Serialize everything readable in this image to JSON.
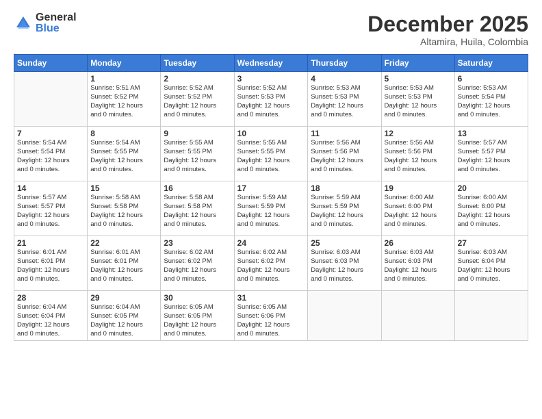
{
  "logo": {
    "general": "General",
    "blue": "Blue"
  },
  "title": {
    "month": "December 2025",
    "location": "Altamira, Huila, Colombia"
  },
  "days_header": [
    "Sunday",
    "Monday",
    "Tuesday",
    "Wednesday",
    "Thursday",
    "Friday",
    "Saturday"
  ],
  "weeks": [
    [
      {
        "day": "",
        "info": ""
      },
      {
        "day": "1",
        "info": "Sunrise: 5:51 AM\nSunset: 5:52 PM\nDaylight: 12 hours\nand 0 minutes."
      },
      {
        "day": "2",
        "info": "Sunrise: 5:52 AM\nSunset: 5:52 PM\nDaylight: 12 hours\nand 0 minutes."
      },
      {
        "day": "3",
        "info": "Sunrise: 5:52 AM\nSunset: 5:53 PM\nDaylight: 12 hours\nand 0 minutes."
      },
      {
        "day": "4",
        "info": "Sunrise: 5:53 AM\nSunset: 5:53 PM\nDaylight: 12 hours\nand 0 minutes."
      },
      {
        "day": "5",
        "info": "Sunrise: 5:53 AM\nSunset: 5:53 PM\nDaylight: 12 hours\nand 0 minutes."
      },
      {
        "day": "6",
        "info": "Sunrise: 5:53 AM\nSunset: 5:54 PM\nDaylight: 12 hours\nand 0 minutes."
      }
    ],
    [
      {
        "day": "7",
        "info": "Sunrise: 5:54 AM\nSunset: 5:54 PM\nDaylight: 12 hours\nand 0 minutes."
      },
      {
        "day": "8",
        "info": "Sunrise: 5:54 AM\nSunset: 5:55 PM\nDaylight: 12 hours\nand 0 minutes."
      },
      {
        "day": "9",
        "info": "Sunrise: 5:55 AM\nSunset: 5:55 PM\nDaylight: 12 hours\nand 0 minutes."
      },
      {
        "day": "10",
        "info": "Sunrise: 5:55 AM\nSunset: 5:55 PM\nDaylight: 12 hours\nand 0 minutes."
      },
      {
        "day": "11",
        "info": "Sunrise: 5:56 AM\nSunset: 5:56 PM\nDaylight: 12 hours\nand 0 minutes."
      },
      {
        "day": "12",
        "info": "Sunrise: 5:56 AM\nSunset: 5:56 PM\nDaylight: 12 hours\nand 0 minutes."
      },
      {
        "day": "13",
        "info": "Sunrise: 5:57 AM\nSunset: 5:57 PM\nDaylight: 12 hours\nand 0 minutes."
      }
    ],
    [
      {
        "day": "14",
        "info": "Sunrise: 5:57 AM\nSunset: 5:57 PM\nDaylight: 12 hours\nand 0 minutes."
      },
      {
        "day": "15",
        "info": "Sunrise: 5:58 AM\nSunset: 5:58 PM\nDaylight: 12 hours\nand 0 minutes."
      },
      {
        "day": "16",
        "info": "Sunrise: 5:58 AM\nSunset: 5:58 PM\nDaylight: 12 hours\nand 0 minutes."
      },
      {
        "day": "17",
        "info": "Sunrise: 5:59 AM\nSunset: 5:59 PM\nDaylight: 12 hours\nand 0 minutes."
      },
      {
        "day": "18",
        "info": "Sunrise: 5:59 AM\nSunset: 5:59 PM\nDaylight: 12 hours\nand 0 minutes."
      },
      {
        "day": "19",
        "info": "Sunrise: 6:00 AM\nSunset: 6:00 PM\nDaylight: 12 hours\nand 0 minutes."
      },
      {
        "day": "20",
        "info": "Sunrise: 6:00 AM\nSunset: 6:00 PM\nDaylight: 12 hours\nand 0 minutes."
      }
    ],
    [
      {
        "day": "21",
        "info": "Sunrise: 6:01 AM\nSunset: 6:01 PM\nDaylight: 12 hours\nand 0 minutes."
      },
      {
        "day": "22",
        "info": "Sunrise: 6:01 AM\nSunset: 6:01 PM\nDaylight: 12 hours\nand 0 minutes."
      },
      {
        "day": "23",
        "info": "Sunrise: 6:02 AM\nSunset: 6:02 PM\nDaylight: 12 hours\nand 0 minutes."
      },
      {
        "day": "24",
        "info": "Sunrise: 6:02 AM\nSunset: 6:02 PM\nDaylight: 12 hours\nand 0 minutes."
      },
      {
        "day": "25",
        "info": "Sunrise: 6:03 AM\nSunset: 6:03 PM\nDaylight: 12 hours\nand 0 minutes."
      },
      {
        "day": "26",
        "info": "Sunrise: 6:03 AM\nSunset: 6:03 PM\nDaylight: 12 hours\nand 0 minutes."
      },
      {
        "day": "27",
        "info": "Sunrise: 6:03 AM\nSunset: 6:04 PM\nDaylight: 12 hours\nand 0 minutes."
      }
    ],
    [
      {
        "day": "28",
        "info": "Sunrise: 6:04 AM\nSunset: 6:04 PM\nDaylight: 12 hours\nand 0 minutes."
      },
      {
        "day": "29",
        "info": "Sunrise: 6:04 AM\nSunset: 6:05 PM\nDaylight: 12 hours\nand 0 minutes."
      },
      {
        "day": "30",
        "info": "Sunrise: 6:05 AM\nSunset: 6:05 PM\nDaylight: 12 hours\nand 0 minutes."
      },
      {
        "day": "31",
        "info": "Sunrise: 6:05 AM\nSunset: 6:06 PM\nDaylight: 12 hours\nand 0 minutes."
      },
      {
        "day": "",
        "info": ""
      },
      {
        "day": "",
        "info": ""
      },
      {
        "day": "",
        "info": ""
      }
    ]
  ]
}
